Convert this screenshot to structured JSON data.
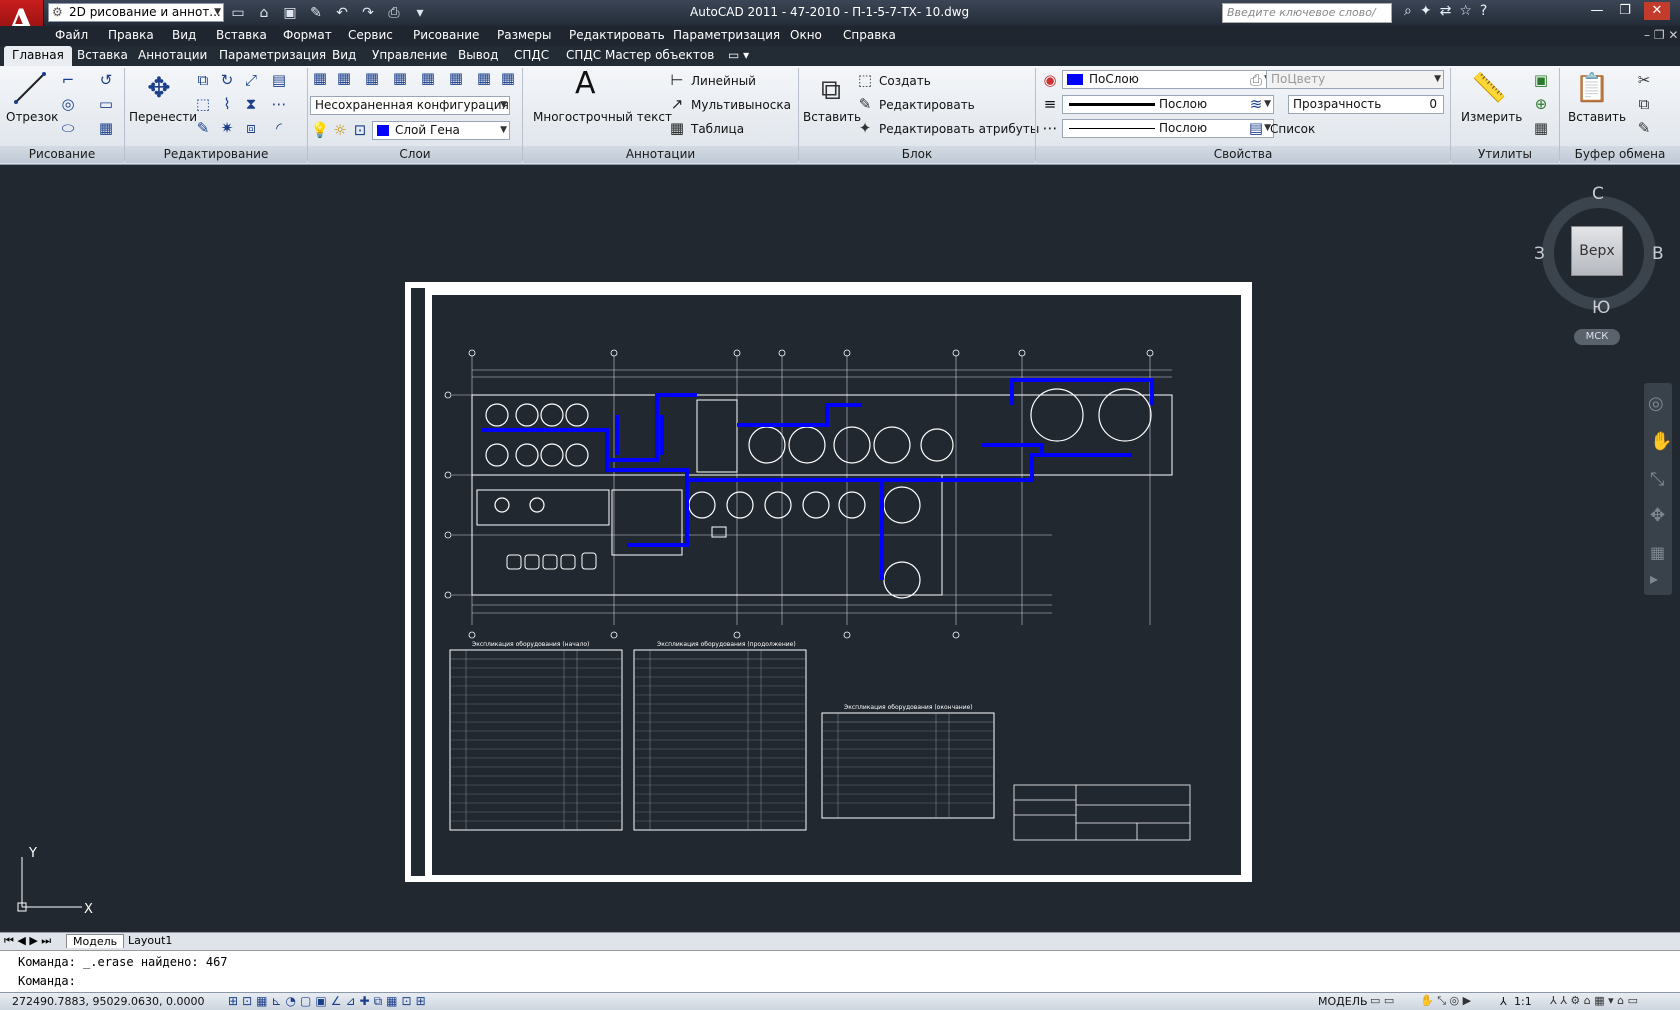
{
  "titlebar": {
    "workspace": "2D рисование и аннот...",
    "window_title": "AutoCAD 2011 - 47-2010 - П-1-5-7-ТХ- 10.dwg",
    "search_placeholder": "Введите ключевое слово/фразу"
  },
  "menu": [
    "Файл",
    "Правка",
    "Вид",
    "Вставка",
    "Формат",
    "Сервис",
    "Рисование",
    "Размеры",
    "Редактировать",
    "Параметризация",
    "Окно",
    "Справка"
  ],
  "ribbon_tabs": [
    "Главная",
    "Вставка",
    "Аннотации",
    "Параметризация",
    "Вид",
    "Управление",
    "Вывод",
    "СПДС",
    "СПДС Мастер объектов"
  ],
  "ribbon": {
    "draw": {
      "line": "Отрезок",
      "footer": "Рисование"
    },
    "modify": {
      "move": "Перенести",
      "footer": "Редактирование"
    },
    "layers": {
      "config": "Несохраненная конфигурация сл",
      "current_layer": "Слой Гена",
      "footer": "Слои"
    },
    "annotation": {
      "mtext": "Многострочный текст",
      "linear": "Линейный",
      "multileader": "Мультивыноска",
      "table": "Таблица",
      "footer": "Аннотации"
    },
    "block": {
      "insert": "Вставить",
      "create": "Создать",
      "edit": "Редактировать",
      "edit_attr": "Редактировать атрибуты",
      "footer": "Блок"
    },
    "properties": {
      "color": "ПоСлою",
      "lineweight": "Послою",
      "linetype": "Послою",
      "plotstyle": "ПоЦвету",
      "transparency": "Прозрачность",
      "transparency_value": "0",
      "list": "Список",
      "footer": "Свойства"
    },
    "utilities": {
      "measure": "Измерить",
      "footer": "Утилиты"
    },
    "clipboard": {
      "paste": "Вставить",
      "footer": "Буфер обмена"
    }
  },
  "viewcube": {
    "north": "С",
    "south": "Ю",
    "west": "З",
    "east": "В",
    "face": "Верх",
    "ucs": "МСК"
  },
  "layout_tabs": [
    "Модель",
    "Layout1"
  ],
  "command": {
    "line1": "Команда:  _.erase найдено: 467",
    "line2": "Команда:"
  },
  "status": {
    "coords": "272490.7883, 95029.0630, 0.0000",
    "mode": "МОДЕЛЬ",
    "scale": "1:1"
  },
  "sheet_tables": [
    "Экспликация оборудования (начало)",
    "Экспликация оборудования (продолжение)",
    "Экспликация оборудования (окончание)"
  ],
  "colors": {
    "accent_blue": "#0000ff",
    "canvas": "#212830",
    "title_bar": "#2e3846"
  }
}
